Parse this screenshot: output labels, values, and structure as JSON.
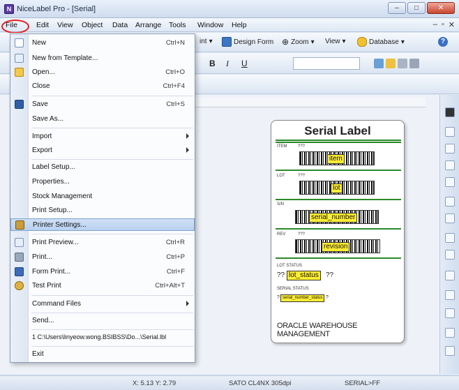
{
  "window": {
    "title": "NiceLabel Pro - [Serial]",
    "buttons": [
      "–",
      "□",
      "✕"
    ]
  },
  "menubar": {
    "items": [
      "File",
      "Edit",
      "View",
      "Object",
      "Data",
      "Arrange",
      "Tools",
      "Window",
      "Help"
    ]
  },
  "toolbar": {
    "print_label": "int",
    "design_form": "Design Form",
    "zoom": "Zoom",
    "view": "View",
    "database": "Database",
    "bold": "B",
    "italic": "I",
    "underline": "U"
  },
  "file_menu": {
    "items": [
      {
        "label": "New",
        "shortcut": "Ctrl+N",
        "submenu": false,
        "icon": "new-document-icon"
      },
      {
        "label": "New from Template...",
        "shortcut": "",
        "submenu": false,
        "icon": "template-icon"
      },
      {
        "label": "Open...",
        "shortcut": "Ctrl+O",
        "submenu": false,
        "icon": "open-folder-icon"
      },
      {
        "label": "Close",
        "shortcut": "Ctrl+F4",
        "submenu": false,
        "icon": ""
      },
      {
        "label": "Save",
        "shortcut": "Ctrl+S",
        "submenu": false,
        "icon": "save-icon"
      },
      {
        "label": "Save As...",
        "shortcut": "",
        "submenu": false,
        "icon": ""
      },
      {
        "label": "Import",
        "shortcut": "",
        "submenu": true,
        "icon": ""
      },
      {
        "label": "Export",
        "shortcut": "",
        "submenu": true,
        "icon": ""
      },
      {
        "label": "Label Setup...",
        "shortcut": "",
        "submenu": false,
        "icon": ""
      },
      {
        "label": "Properties...",
        "shortcut": "",
        "submenu": false,
        "icon": ""
      },
      {
        "label": "Stock Management",
        "shortcut": "",
        "submenu": false,
        "icon": ""
      },
      {
        "label": "Print Setup...",
        "shortcut": "",
        "submenu": false,
        "icon": ""
      },
      {
        "label": "Printer Settings...",
        "shortcut": "",
        "submenu": false,
        "icon": "printer-settings-icon"
      },
      {
        "label": "Print Preview...",
        "shortcut": "Ctrl+R",
        "submenu": false,
        "icon": "print-preview-icon"
      },
      {
        "label": "Print...",
        "shortcut": "Ctrl+P",
        "submenu": false,
        "icon": "print-icon"
      },
      {
        "label": "Form Print...",
        "shortcut": "Ctrl+F",
        "submenu": false,
        "icon": "form-print-icon"
      },
      {
        "label": "Test Print",
        "shortcut": "Ctrl+Alt+T",
        "submenu": false,
        "icon": "test-print-icon"
      },
      {
        "label": "Command Files",
        "shortcut": "",
        "submenu": true,
        "icon": ""
      },
      {
        "label": "Send...",
        "shortcut": "",
        "submenu": false,
        "icon": ""
      },
      {
        "label": "1 C:\\Users\\linyeow.wong.BSIBSS\\Do...\\Serial.lbl",
        "shortcut": "",
        "submenu": false,
        "icon": ""
      },
      {
        "label": "Exit",
        "shortcut": "",
        "submenu": false,
        "icon": ""
      }
    ],
    "highlighted_index": 12
  },
  "label": {
    "title": "Serial Label",
    "rows": [
      {
        "caption": "ITEM",
        "small_value": "???",
        "var": "item"
      },
      {
        "caption": "LOT",
        "small_value": "???",
        "var": "lot"
      },
      {
        "caption": "S/N",
        "small_value": "",
        "var": "serial_number"
      },
      {
        "caption": "REV",
        "small_value": "???",
        "var": "revision"
      }
    ],
    "lot_status_caption": "LOT STATUS",
    "lot_status_prefix": "??",
    "lot_status_var": "lot_status",
    "lot_status_suffix": "??",
    "serial_status_caption": "SERIAL STATUS",
    "serial_status_prefix": "?",
    "serial_status_var": "serial_number_status",
    "serial_status_suffix": "?",
    "footer": "ORACLE WAREHOUSE MANAGEMENT"
  },
  "statusbar": {
    "coords": "X: 5.13 Y: 2.79",
    "printer": "SATO CL4NX 305dpi",
    "port": "SERIAL>FF"
  },
  "colors": {
    "highlight_circle": "#e02020",
    "var_fill": "#ffee33",
    "label_lines": "#2a8a2a"
  }
}
